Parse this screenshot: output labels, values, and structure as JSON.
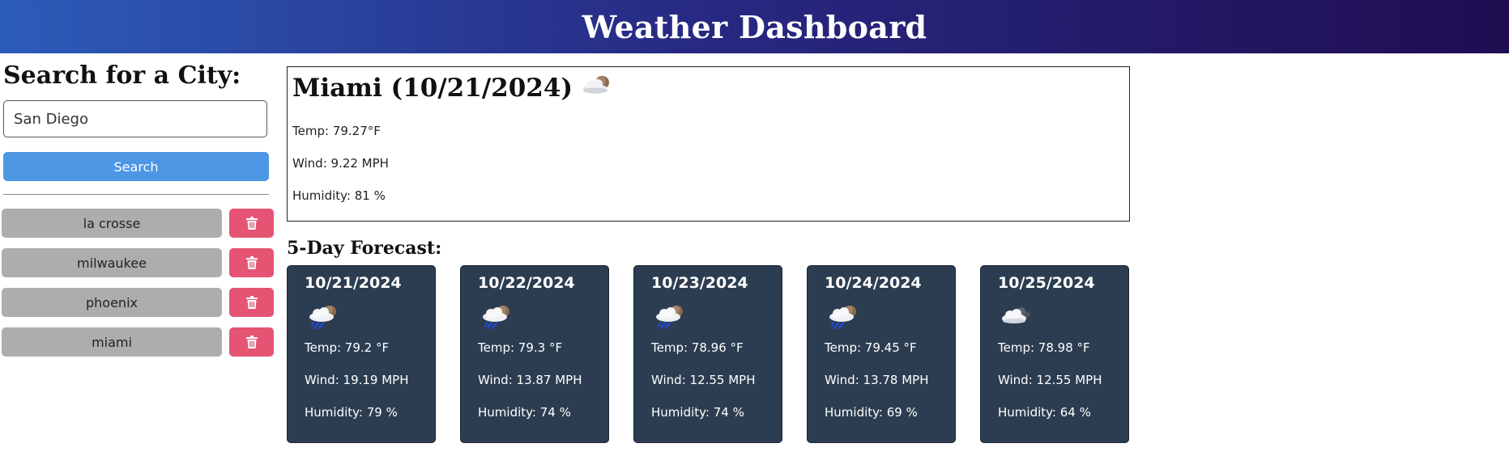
{
  "header": {
    "title": "Weather Dashboard"
  },
  "sidebar": {
    "title": "Search for a City:",
    "search_value": "San Diego",
    "search_button_label": "Search",
    "history": [
      {
        "label": "la crosse"
      },
      {
        "label": "milwaukee"
      },
      {
        "label": "phoenix"
      },
      {
        "label": "miami"
      }
    ],
    "delete_icon": "trash-icon"
  },
  "current": {
    "title": "Miami (10/21/2024)",
    "icon": "partly-cloudy-icon",
    "temp": "Temp: 79.27°F",
    "wind": "Wind: 9.22 MPH",
    "humidity": "Humidity: 81 %"
  },
  "forecast": {
    "title": "5-Day Forecast:",
    "days": [
      {
        "date": "10/21/2024",
        "icon": "rain-cloud-icon",
        "temp": "Temp: 79.2 °F",
        "wind": "Wind: 19.19 MPH",
        "humidity": "Humidity: 79 %"
      },
      {
        "date": "10/22/2024",
        "icon": "rain-cloud-icon",
        "temp": "Temp: 79.3 °F",
        "wind": "Wind: 13.87 MPH",
        "humidity": "Humidity: 74 %"
      },
      {
        "date": "10/23/2024",
        "icon": "rain-cloud-icon",
        "temp": "Temp: 78.96 °F",
        "wind": "Wind: 12.55 MPH",
        "humidity": "Humidity: 74 %"
      },
      {
        "date": "10/24/2024",
        "icon": "rain-cloud-icon",
        "temp": "Temp: 79.45 °F",
        "wind": "Wind: 13.78 MPH",
        "humidity": "Humidity: 69 %"
      },
      {
        "date": "10/25/2024",
        "icon": "cloudy-icon",
        "temp": "Temp: 78.98 °F",
        "wind": "Wind: 12.55 MPH",
        "humidity": "Humidity: 64 %"
      }
    ]
  },
  "colors": {
    "header_gradient_start": "#2c5cb9",
    "header_gradient_end": "#200d52",
    "search_button": "#4c96e4",
    "history_button": "#adadad",
    "delete_button": "#e55472",
    "forecast_card": "#2c3d51"
  }
}
